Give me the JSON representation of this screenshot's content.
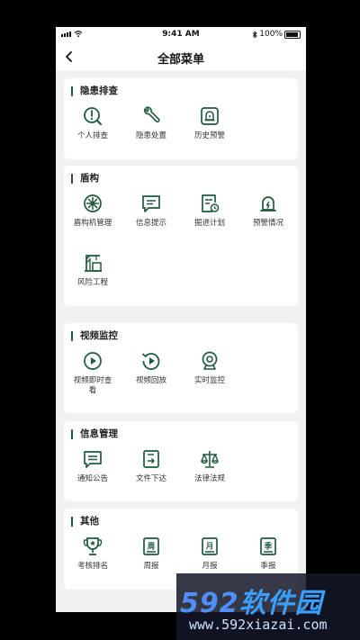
{
  "status_bar": {
    "time": "9:41 AM",
    "battery": "100%"
  },
  "nav": {
    "title": "全部菜单"
  },
  "sections": [
    {
      "title": "隐患排查",
      "items": [
        "个人排查",
        "隐患处置",
        "历史预警"
      ]
    },
    {
      "title": "盾构",
      "items": [
        "盾构机管理",
        "信息提示",
        "掘进计划",
        "预警情况",
        "风险工程"
      ]
    },
    {
      "title": "视频监控",
      "items": [
        "视频即时查看",
        "视频回放",
        "实时监控"
      ]
    },
    {
      "title": "信息管理",
      "items": [
        "通知公告",
        "文件下达",
        "法律法规"
      ]
    },
    {
      "title": "其他",
      "items": [
        "考核排名",
        "周报",
        "月报",
        "季报"
      ]
    }
  ],
  "icon_glyphs": {
    "weekly": "周",
    "monthly": "月",
    "quarterly": "季"
  },
  "colors": {
    "accent": "#1d5b3c",
    "background": "#f1f1f1"
  },
  "watermark": {
    "brand_num": "592",
    "brand_cn": "软件园",
    "url": "www.592xiazai.com"
  }
}
